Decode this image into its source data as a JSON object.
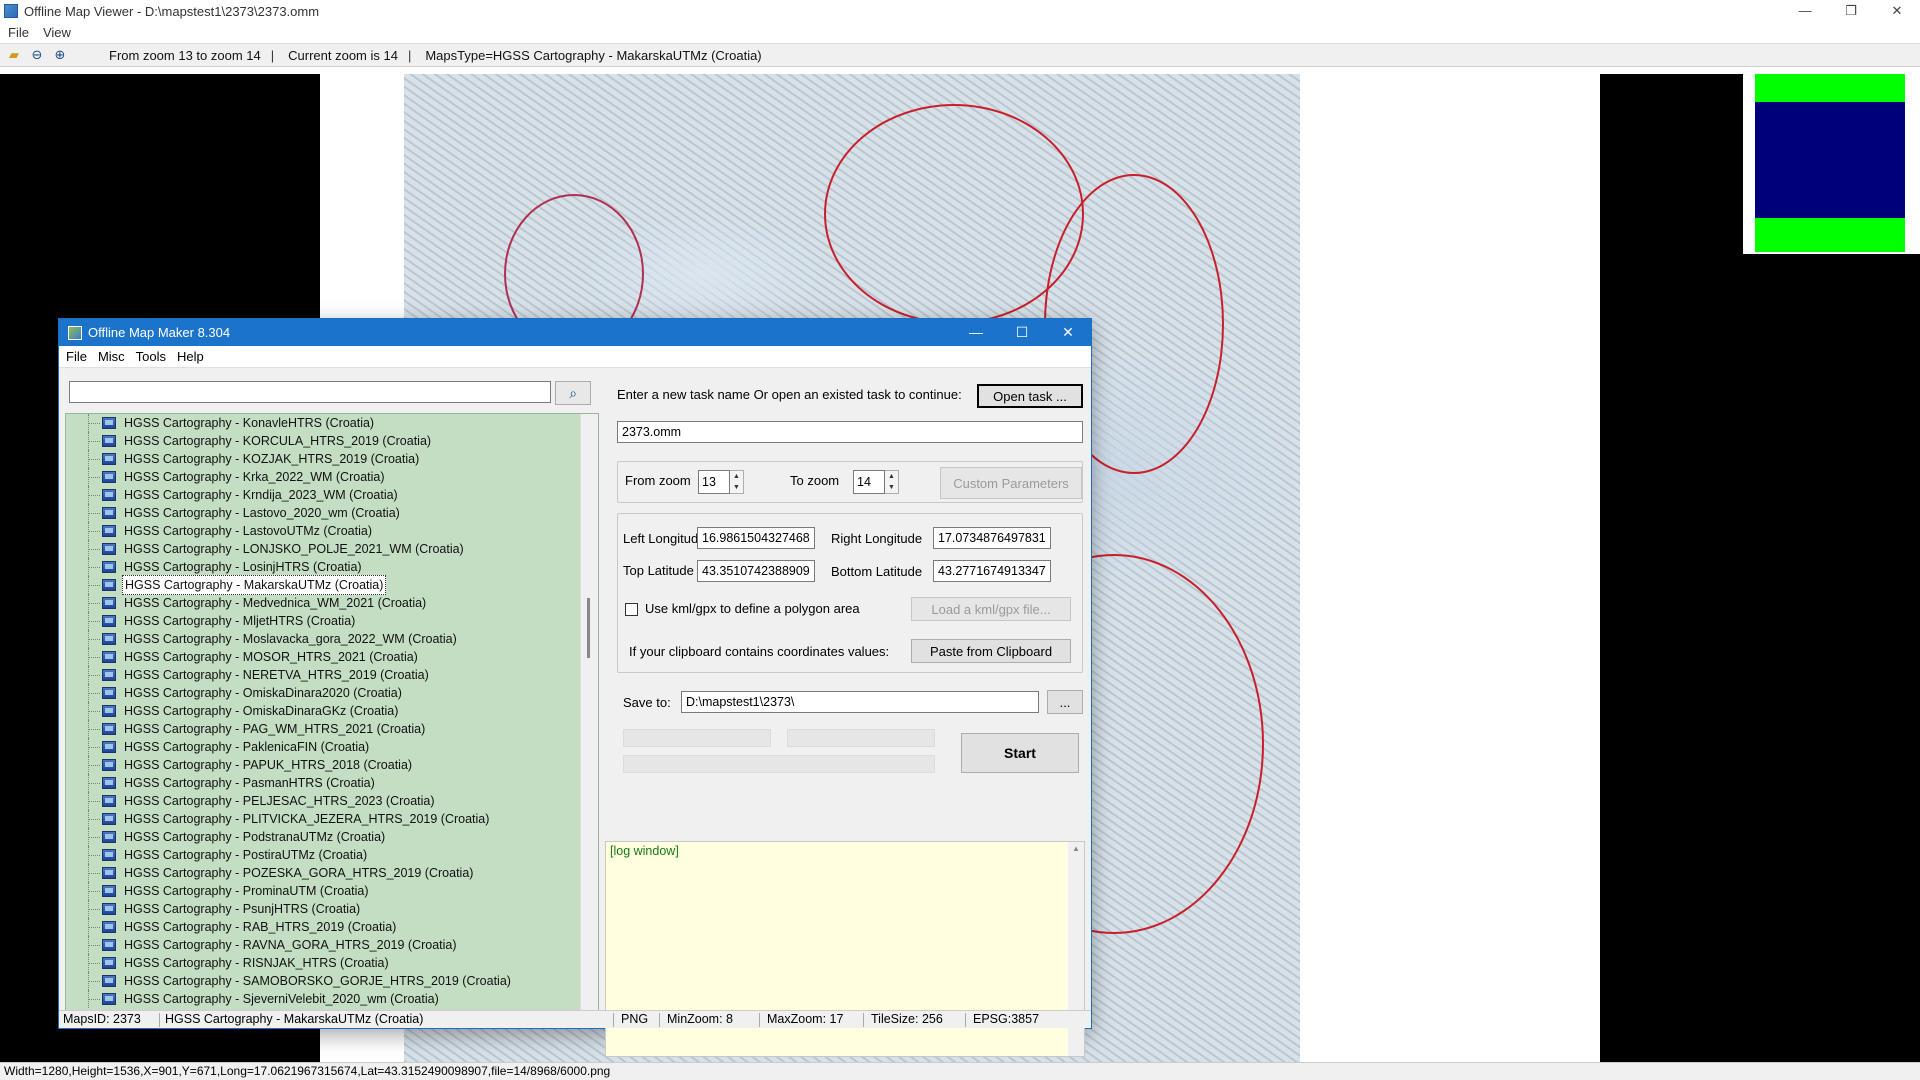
{
  "viewer": {
    "title": "Offline Map Viewer - D:\\mapstest1\\2373\\2373.omm",
    "window_controls": {
      "minimize": "—",
      "maximize": "❐",
      "close": "✕"
    },
    "menu": [
      "File",
      "View"
    ],
    "toolbar": {
      "zoom_range": "From zoom 13 to zoom 14",
      "sep": "|",
      "current_zoom": "Current zoom is 14",
      "maps_type": "MapsType=HGSS Cartography - MakarskaUTMz (Croatia)"
    },
    "status": "Width=1280,Height=1536,X=901,Y=671,Long=17.0621967315674,Lat=43.3152490098907,file=14/8968/6000.png"
  },
  "maker": {
    "title": "Offline Map Maker 8.304",
    "window_controls": {
      "minimize": "—",
      "maximize": "☐",
      "close": "✕"
    },
    "menu": [
      "File",
      "Misc",
      "Tools",
      "Help"
    ],
    "search_value": "",
    "maps": [
      "HGSS Cartography - KonavleHTRS (Croatia)",
      "HGSS Cartography - KORCULA_HTRS_2019 (Croatia)",
      "HGSS Cartography - KOZJAK_HTRS_2019 (Croatia)",
      "HGSS Cartography - Krka_2022_WM (Croatia)",
      "HGSS Cartography - Krndija_2023_WM (Croatia)",
      "HGSS Cartography - Lastovo_2020_wm (Croatia)",
      "HGSS Cartography - LastovoUTMz (Croatia)",
      "HGSS Cartography - LONJSKO_POLJE_2021_WM (Croatia)",
      "HGSS Cartography - LosinjHTRS (Croatia)",
      "HGSS Cartography - MakarskaUTMz (Croatia)",
      "HGSS Cartography - Medvednica_WM_2021 (Croatia)",
      "HGSS Cartography - MljetHTRS (Croatia)",
      "HGSS Cartography - Moslavacka_gora_2022_WM (Croatia)",
      "HGSS Cartography - MOSOR_HTRS_2021 (Croatia)",
      "HGSS Cartography - NERETVA_HTRS_2019 (Croatia)",
      "HGSS Cartography - OmiskaDinara2020 (Croatia)",
      "HGSS Cartography - OmiskaDinaraGKz (Croatia)",
      "HGSS Cartography - PAG_WM_HTRS_2021 (Croatia)",
      "HGSS Cartography - PaklenicaFIN (Croatia)",
      "HGSS Cartography - PAPUK_HTRS_2018 (Croatia)",
      "HGSS Cartography - PasmanHTRS (Croatia)",
      "HGSS Cartography - PELJESAC_HTRS_2023 (Croatia)",
      "HGSS Cartography - PLITVICKA_JEZERA_HTRS_2019 (Croatia)",
      "HGSS Cartography - PodstranaUTMz (Croatia)",
      "HGSS Cartography - PostiraUTMz (Croatia)",
      "HGSS Cartography - POZESKA_GORA_HTRS_2019 (Croatia)",
      "HGSS Cartography - ProminaUTM (Croatia)",
      "HGSS Cartography - PsunjHTRS (Croatia)",
      "HGSS Cartography - RAB_HTRS_2019 (Croatia)",
      "HGSS Cartography - RAVNA_GORA_HTRS_2019 (Croatia)",
      "HGSS Cartography - RISNJAK_HTRS (Croatia)",
      "HGSS Cartography - SAMOBORSKO_GORJE_HTRS_2019 (Croatia)",
      "HGSS Cartography - SjeverniVelebit_2020_wm (Croatia)"
    ],
    "task_label": "Enter a new task name Or open an existed task to continue:",
    "open_task_button": "Open task ...",
    "task_name": "2373.omm",
    "from_zoom_label": "From zoom",
    "from_zoom": "13",
    "to_zoom_label": "To zoom",
    "to_zoom": "14",
    "custom_params_button": "Custom Parameters",
    "left_lon_label": "Left Longitude",
    "left_lon": "16.9861504327468",
    "right_lon_label": "Right Longitude",
    "right_lon": "17.0734876497831",
    "top_lat_label": "Top Latitude",
    "top_lat": "43.3510742388909",
    "bottom_lat_label": "Bottom Latitude",
    "bottom_lat": "43.2771674913347",
    "kml_checkbox_label": "Use kml/gpx to define a polygon area",
    "load_kml_button": "Load a kml/gpx file...",
    "clipboard_label": "If your clipboard contains coordinates values:",
    "paste_button": "Paste from Clipboard",
    "save_to_label": "Save to:",
    "save_to": "D:\\mapstest1\\2373\\",
    "browse_button": "...",
    "start_button": "Start",
    "log_title": "[log window]",
    "status": {
      "maps_id": "MapsID: 2373",
      "map_name": "HGSS Cartography - MakarskaUTMz (Croatia)",
      "format": "PNG",
      "min_zoom": "MinZoom: 8",
      "max_zoom": "MaxZoom: 17",
      "tile_size": "TileSize: 256",
      "epsg": "EPSG:3857"
    }
  }
}
